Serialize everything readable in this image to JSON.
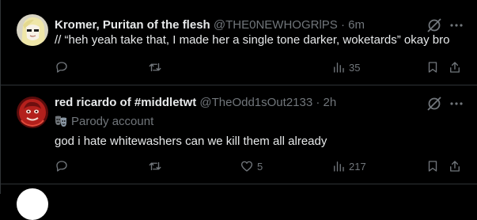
{
  "colors": {
    "background": "#000000",
    "text_primary": "#e7e9ea",
    "text_secondary": "#71767b",
    "divider": "#2f3336"
  },
  "tweets": [
    {
      "display_name": "Kromer, Puritan of the flesh",
      "handle": "@THE0NEWHOGRlPS",
      "separator": "·",
      "time": "6m",
      "text": "// “heh yeah take that, I made her a single tone darker, woketards” okay bro",
      "views": "35",
      "icons": [
        "grok-icon",
        "more-icon",
        "reply-icon",
        "repost-icon",
        "views-icon",
        "bookmark-icon",
        "share-icon"
      ]
    },
    {
      "display_name": "red ricardo of #middletwt",
      "handle": "@TheOdd1sOut2133",
      "separator": "·",
      "time": "2h",
      "parody_label": "Parody account",
      "text": "god i hate whitewashers can we kill them all already",
      "likes": "5",
      "views": "217",
      "icons": [
        "grok-icon",
        "more-icon",
        "parody-mask-icon",
        "reply-icon",
        "repost-icon",
        "like-icon",
        "views-icon",
        "bookmark-icon",
        "share-icon"
      ]
    }
  ]
}
